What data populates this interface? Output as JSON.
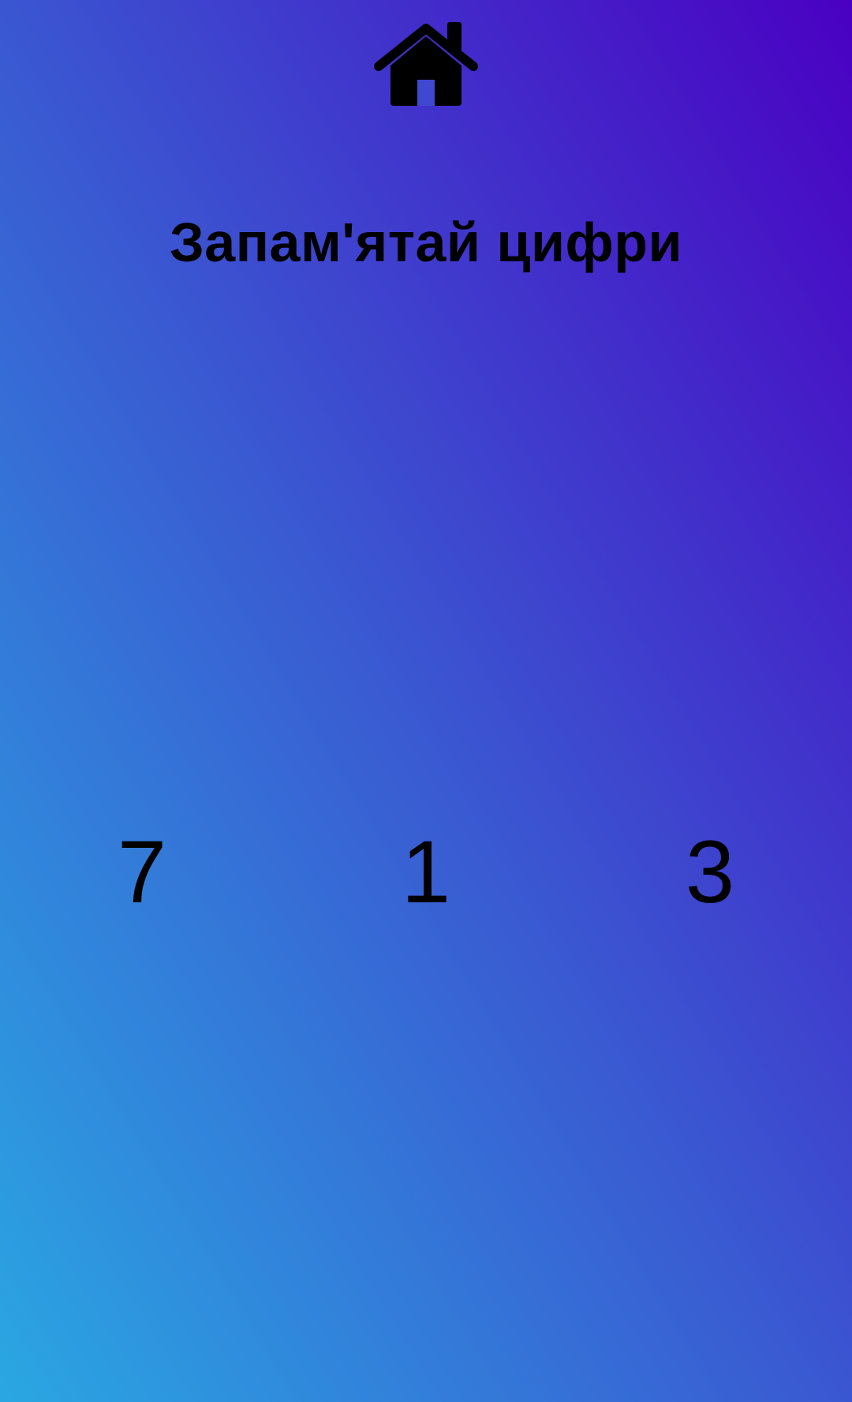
{
  "header": {
    "home_icon": "home-icon"
  },
  "main": {
    "title": "Запам'ятай цифри",
    "digits": [
      "7",
      "1",
      "3"
    ]
  },
  "colors": {
    "gradient_top_right": "#4a00c2",
    "gradient_middle": "#3a5ad2",
    "gradient_bottom_left": "#2aa7e2",
    "text": "#000000"
  }
}
